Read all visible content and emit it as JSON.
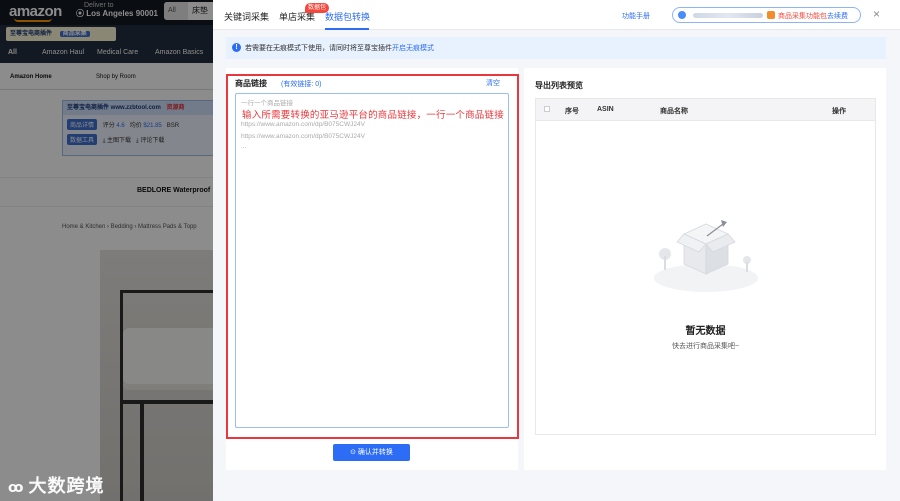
{
  "background_page": {
    "logo": "amazon",
    "deliver_line1": "Deliver to",
    "deliver_line2": "Los Angeles 90001",
    "search_scope": "All",
    "search_query": "床垫",
    "plugin_logo": "至尊宝电商插件",
    "plugin_search_btn": "商品采集",
    "nav_items": [
      "All",
      "Amazon Haul",
      "Medical Care",
      "Amazon Basics"
    ],
    "sub_items": [
      "Amazon Home",
      "Shop by Room"
    ],
    "widget": {
      "header": "至尊宝电商插件 www.zzbtool.com",
      "header_right": "资源商",
      "detail_chip": "商品详情",
      "rating_label": "评分",
      "rating": "4.6",
      "price_label": "均价",
      "price": "$21.85",
      "bsr_label": "BSR",
      "tools_chip": "数据工具",
      "main_image_download": "主图下载",
      "review_download": "评论下载"
    },
    "product_title": "BEDLORE Waterproof",
    "breadcrumb": "Home & Kitchen › Bedding › Mattress Pads & Topp"
  },
  "watermark": "大数跨境",
  "dialog": {
    "tabs": [
      {
        "label": "关键词采集",
        "active": false
      },
      {
        "label": "单店采集",
        "active": false
      },
      {
        "label": "数据包转换",
        "active": true
      }
    ],
    "tab_badge": "数据包",
    "manual_link": "功能手册",
    "account": {
      "package_label": "商品采集功能包",
      "renew_link": "去续费"
    },
    "close_icon": "×",
    "notice": {
      "text": "若需要在无痕模式下使用，请同时将至尊宝插件",
      "link": "开启无痕模式"
    },
    "left_panel": {
      "title": "商品链接",
      "valid_count": "(有效链接: 0)",
      "clear_link": "清空",
      "placeholder_lines": [
        "一行一个商品链接",
        "https://www.amazon.com/dp/B075CWJ24V",
        "https://www.amazon.com/dp/B075CWJ24V",
        "..."
      ],
      "annotation": "输入所需要转换的亚马逊平台的商品链接，一行一个商品链接",
      "confirm_button": "确认并转换",
      "confirm_icon": "⊙"
    },
    "right_panel": {
      "title": "导出列表预览",
      "columns": [
        "序号",
        "ASIN",
        "商品名称",
        "操作"
      ],
      "empty_title": "暂无数据",
      "empty_subtitle": "快去进行商品采集吧~"
    }
  }
}
